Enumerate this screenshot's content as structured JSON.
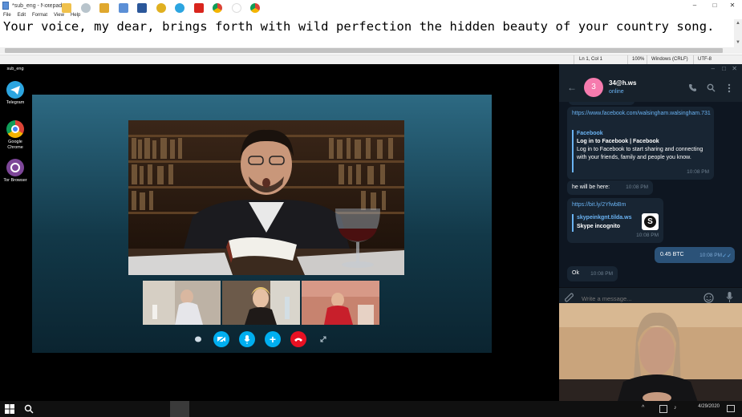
{
  "notepad": {
    "title": "*sub_eng - Notepad",
    "menu": [
      "File",
      "Edit",
      "Format",
      "View",
      "Help"
    ],
    "text": "Your voice, my dear, brings forth with wild perfection the hidden beauty of your country song.",
    "status": {
      "position": "Ln 1, Col 1",
      "zoom": "100%",
      "line_endings": "Windows (CRLF)",
      "encoding": "UTF-8"
    }
  },
  "desktop": {
    "icons": [
      {
        "label": "sub_eng",
        "color": "#6b6b6b"
      },
      {
        "label": "Telegram",
        "color": "#2ca5e0"
      },
      {
        "label": "Google Chrome",
        "color": "#db4437"
      },
      {
        "label": "Tor Browser",
        "color": "#7d4698"
      }
    ]
  },
  "skype": {
    "controls": [
      "chat-icon",
      "video-off-icon",
      "mic-icon",
      "add-icon",
      "hangup-icon",
      "fullscreen-icon"
    ]
  },
  "telegram": {
    "contact": {
      "avatar_letter": "3",
      "name": "34@h.ws",
      "status": "online"
    },
    "messages": {
      "m1_url": "https://www.facebook.com/walsingham.walsingham.731",
      "m1_preview_site": "Facebook",
      "m1_preview_title": "Log in to Facebook | Facebook",
      "m1_preview_desc": "Log in to Facebook to start sharing and connecting with your friends, family and people you know.",
      "m1_time": "10:08 PM",
      "m2_text": "he will be here:",
      "m2_time": "10:08 PM",
      "m3_url": "https://bit.ly/2YfwbBm",
      "m3_preview_site": "skypeinkgnt.tilda.ws",
      "m3_preview_title": "Skype incognito",
      "m3_time": "10:08 PM",
      "m4_text": "0.45 BTC",
      "m4_time": "10:08 PM",
      "m5_text": "Ok",
      "m5_time": "10:08 PM"
    },
    "input_placeholder": "Write a message..."
  },
  "taskbar": {
    "date": "4/29/2020"
  },
  "colors": {
    "telegram_bg": "#0e1621",
    "telegram_panel": "#17212b",
    "incoming_bubble": "#182533",
    "outgoing_bubble": "#2b5278",
    "link": "#6ab3f3",
    "hangup": "#e81123",
    "skype_blue": "#00aff0"
  }
}
